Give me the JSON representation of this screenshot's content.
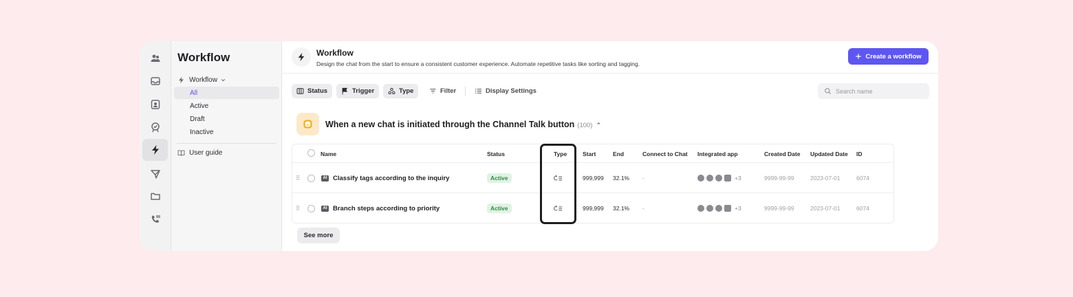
{
  "sidebar": {
    "title": "Workflow",
    "workflow_label": "Workflow",
    "items": [
      {
        "label": "All"
      },
      {
        "label": "Active"
      },
      {
        "label": "Draft"
      },
      {
        "label": "Inactive"
      }
    ],
    "user_guide": "User guide"
  },
  "header": {
    "title": "Workflow",
    "description": "Design the chat from the start to ensure a consistent customer experience. Automate repetitive tasks like sorting and tagging.",
    "create_button": "Create a workflow"
  },
  "filters": {
    "status": "Status",
    "trigger": "Trigger",
    "type": "Type",
    "filter": "Filter",
    "display_settings": "Display Settings",
    "search_placeholder": "Search name"
  },
  "group": {
    "title": "When a new chat is initiated through the Channel Talk button",
    "count": "(100)"
  },
  "table": {
    "headers": {
      "name": "Name",
      "status": "Status",
      "type": "Type",
      "start": "Start",
      "end": "End",
      "connect": "Connect to Chat",
      "apps": "Integrated app",
      "created": "Created Date",
      "updated": "Updated Date",
      "id": "ID"
    },
    "rows": [
      {
        "badge": "AI",
        "name": "Classify tags according to the inquiry",
        "status": "Active",
        "start": "999,999",
        "end": "32.1%",
        "connect": "-",
        "apps_more": "+3",
        "created": "9999-99-99",
        "updated": "2023-07-01",
        "id": "6074"
      },
      {
        "badge": "AI",
        "name": "Branch steps according to priority",
        "status": "Active",
        "start": "999,999",
        "end": "32.1%",
        "connect": "-",
        "apps_more": "+3",
        "created": "9999-99-99",
        "updated": "2023-07-01",
        "id": "6074"
      }
    ]
  },
  "see_more": "See more",
  "colors": {
    "accent": "#5e56f0",
    "background": "#fdebee",
    "active_badge": "#2f8a4a"
  }
}
